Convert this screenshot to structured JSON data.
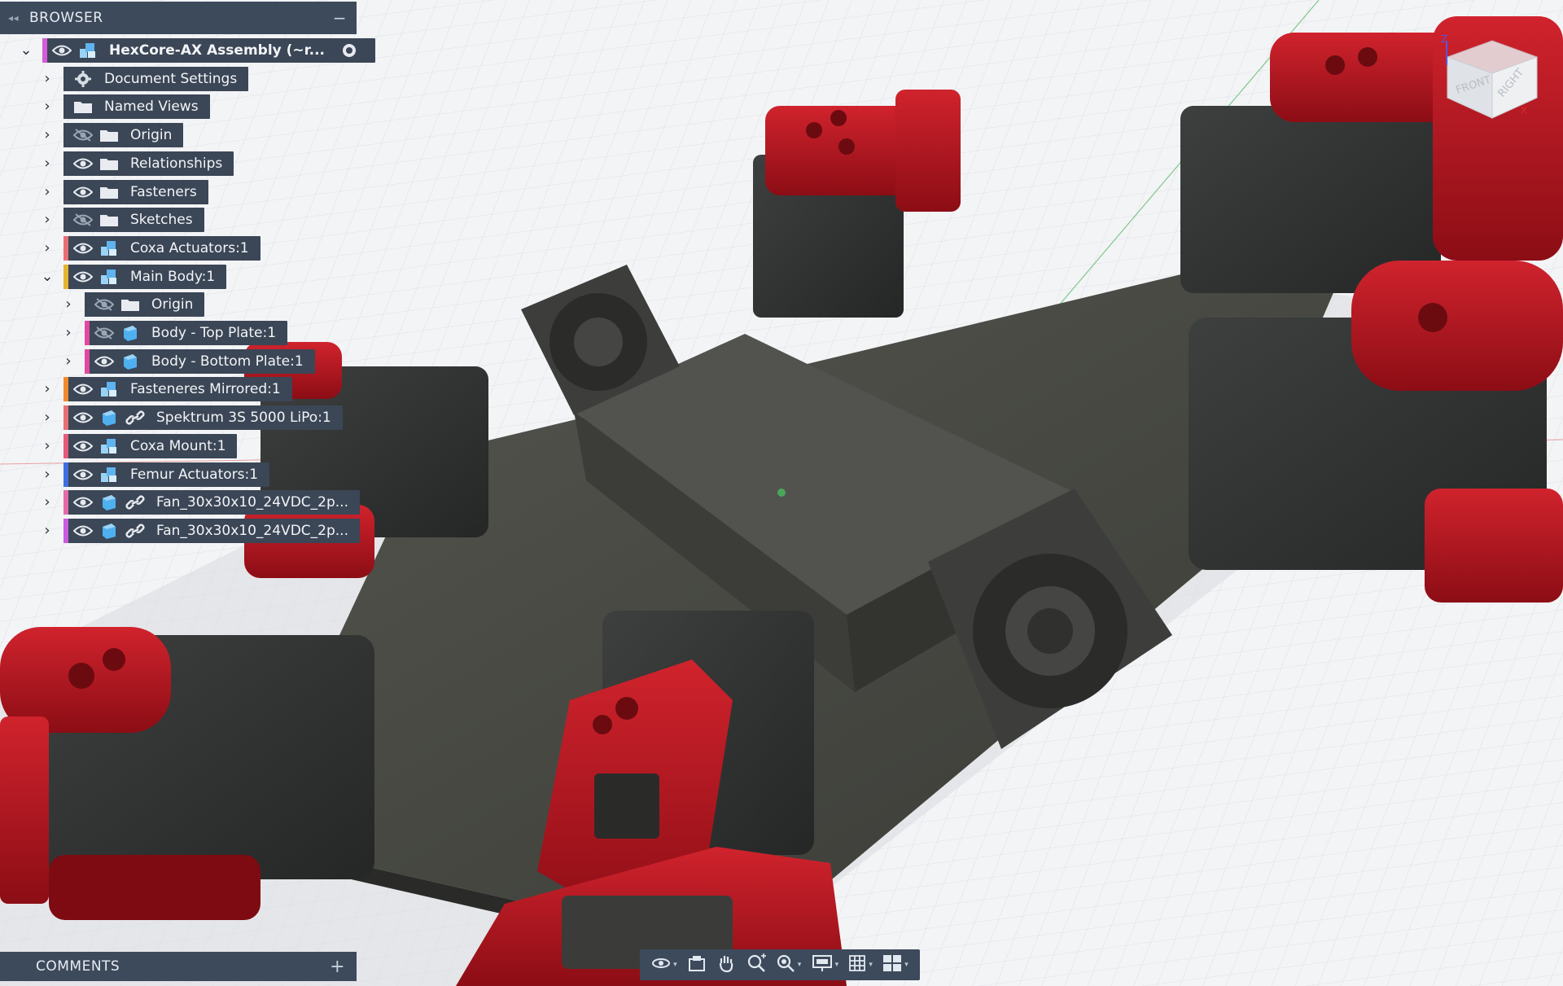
{
  "browser": {
    "title": "BROWSER",
    "collapse_icon": "double-chevron-left-icon",
    "minimize_icon": "minus-icon",
    "tree": [
      {
        "label": "HexCore-AX Assembly (~r...",
        "level": 0,
        "expanded": true,
        "visible": true,
        "icon": "assembly-icon",
        "accent": "#d55bd8",
        "extra_icon": "radio-active-icon",
        "bold": true
      },
      {
        "label": "Document Settings",
        "level": 1,
        "expanded": false,
        "icon": "gear-icon"
      },
      {
        "label": "Named Views",
        "level": 1,
        "expanded": false,
        "icon": "folder-icon"
      },
      {
        "label": "Origin",
        "level": 1,
        "expanded": false,
        "visible": false,
        "icon": "folder-icon"
      },
      {
        "label": "Relationships",
        "level": 1,
        "expanded": false,
        "visible": true,
        "icon": "folder-icon"
      },
      {
        "label": "Fasteners",
        "level": 1,
        "expanded": false,
        "visible": true,
        "icon": "folder-icon"
      },
      {
        "label": "Sketches",
        "level": 1,
        "expanded": false,
        "visible": false,
        "icon": "folder-icon"
      },
      {
        "label": "Coxa Actuators:1",
        "level": 1,
        "expanded": false,
        "visible": true,
        "icon": "component-icon",
        "accent": "#e76e73"
      },
      {
        "label": "Main Body:1",
        "level": 1,
        "expanded": true,
        "visible": true,
        "icon": "component-icon",
        "accent": "#e4b431"
      },
      {
        "label": "Origin",
        "level": 2,
        "expanded": false,
        "visible": false,
        "icon": "folder-icon"
      },
      {
        "label": "Body - Top Plate:1",
        "level": 2,
        "expanded": false,
        "visible": false,
        "icon": "body-icon",
        "accent": "#e04aa0"
      },
      {
        "label": "Body - Bottom Plate:1",
        "level": 2,
        "expanded": false,
        "visible": true,
        "icon": "body-icon",
        "accent": "#e04aa0"
      },
      {
        "label": "Fasteneres Mirrored:1",
        "level": 1,
        "expanded": false,
        "visible": true,
        "icon": "component-icon",
        "accent": "#f08a2e"
      },
      {
        "label": "Spektrum 3S 5000 LiPo:1",
        "level": 1,
        "expanded": false,
        "visible": true,
        "icon": "body-icon",
        "accent": "#e76e73",
        "linked": true
      },
      {
        "label": "Coxa Mount:1",
        "level": 1,
        "expanded": false,
        "visible": true,
        "icon": "component-icon",
        "accent": "#e65a7a"
      },
      {
        "label": "Femur Actuators:1",
        "level": 1,
        "expanded": false,
        "visible": true,
        "icon": "component-icon",
        "accent": "#3f6fe0"
      },
      {
        "label": "Fan_30x30x10_24VDC_2p...",
        "level": 1,
        "expanded": false,
        "visible": true,
        "icon": "body-icon",
        "accent": "#e46aa7",
        "linked": true
      },
      {
        "label": "Fan_30x30x10_24VDC_2p...",
        "level": 1,
        "expanded": false,
        "visible": true,
        "icon": "body-icon",
        "accent": "#c85ce0",
        "linked": true
      }
    ]
  },
  "comments": {
    "title": "COMMENTS",
    "add_icon": "plus-icon"
  },
  "viewcube": {
    "faces": [
      "FRONT",
      "RIGHT"
    ],
    "axis_z_label": "Z",
    "axis_x_label": "X"
  },
  "toolbar": {
    "tools": [
      {
        "name": "orbit-icon",
        "dropdown": true
      },
      {
        "name": "look-at-icon",
        "dropdown": false
      },
      {
        "name": "pan-hand-icon",
        "dropdown": false
      },
      {
        "name": "zoom-icon",
        "dropdown": false
      },
      {
        "name": "fit-icon",
        "dropdown": true
      },
      {
        "name": "display-settings-icon",
        "dropdown": true
      },
      {
        "name": "grid-icon",
        "dropdown": true
      },
      {
        "name": "viewports-icon",
        "dropdown": true
      }
    ]
  },
  "colors": {
    "panel_bg": "#3b4656",
    "robot_red": "#b3121c",
    "body_dark": "#2d2f2e",
    "plate": "#4a4b47",
    "canvas_bg": "#f3f4f6"
  }
}
